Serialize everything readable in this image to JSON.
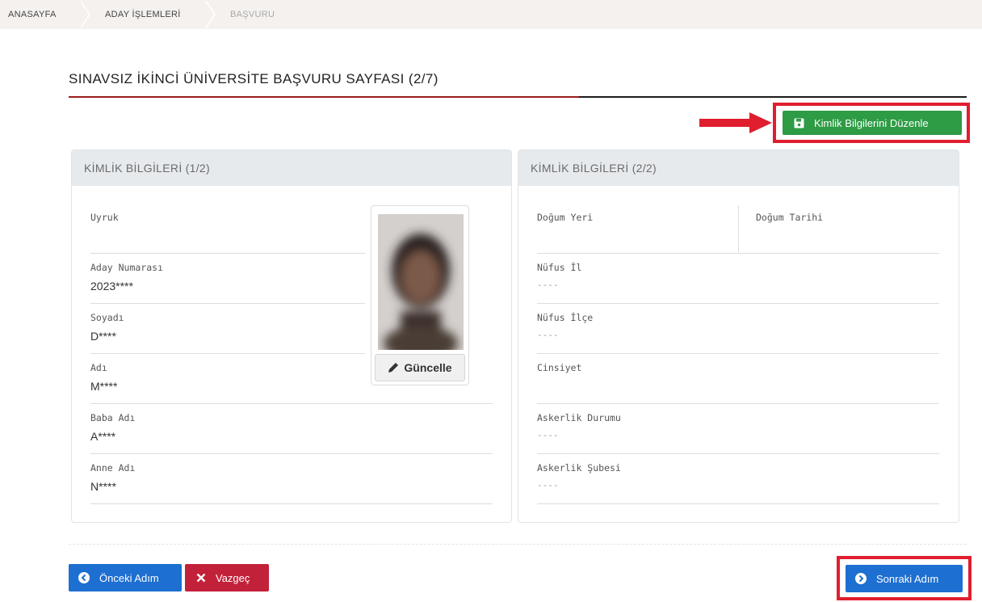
{
  "breadcrumb": {
    "items": [
      "ANASAYFA",
      "ADAY İŞLEMLERİ",
      "BAŞVURU"
    ]
  },
  "page": {
    "title": "SINAVSIZ İKİNCİ ÜNİVERSİTE BAŞVURU SAYFASI (2/7)"
  },
  "actions": {
    "edit_identity_label": "Kimlik Bilgilerini Düzenle",
    "update_photo_label": "Güncelle",
    "prev_label": "Önceki Adım",
    "cancel_label": "Vazgeç",
    "next_label": "Sonraki Adım"
  },
  "left_panel": {
    "heading": "KİMLİK BİLGİLERİ (1/2)",
    "fields": [
      {
        "label": "Uyruk",
        "value": ""
      },
      {
        "label": "Aday Numarası",
        "value": "2023****"
      },
      {
        "label": "Soyadı",
        "value": "D****"
      },
      {
        "label": "Adı",
        "value": "M****"
      },
      {
        "label": "Baba Adı",
        "value": "A****"
      },
      {
        "label": "Anne Adı",
        "value": "N****"
      }
    ]
  },
  "right_panel": {
    "heading": "KİMLİK BİLGİLERİ (2/2)",
    "fields": [
      {
        "label": "Doğum Yeri",
        "value": ""
      },
      {
        "label": "Doğum Tarihi",
        "value": ""
      },
      {
        "label": "Nüfus İl",
        "value": "----"
      },
      {
        "label": "Nüfus İlçe",
        "value": "----"
      },
      {
        "label": "Cinsiyet",
        "value": ""
      },
      {
        "label": "Askerlik Durumu",
        "value": "----"
      },
      {
        "label": "Askerlik Şubesi",
        "value": "----"
      }
    ]
  },
  "colors": {
    "accent_green": "#2e9b45",
    "accent_blue": "#1d6fd1",
    "accent_red": "#c2213a",
    "highlight_red": "#e01e2e"
  }
}
